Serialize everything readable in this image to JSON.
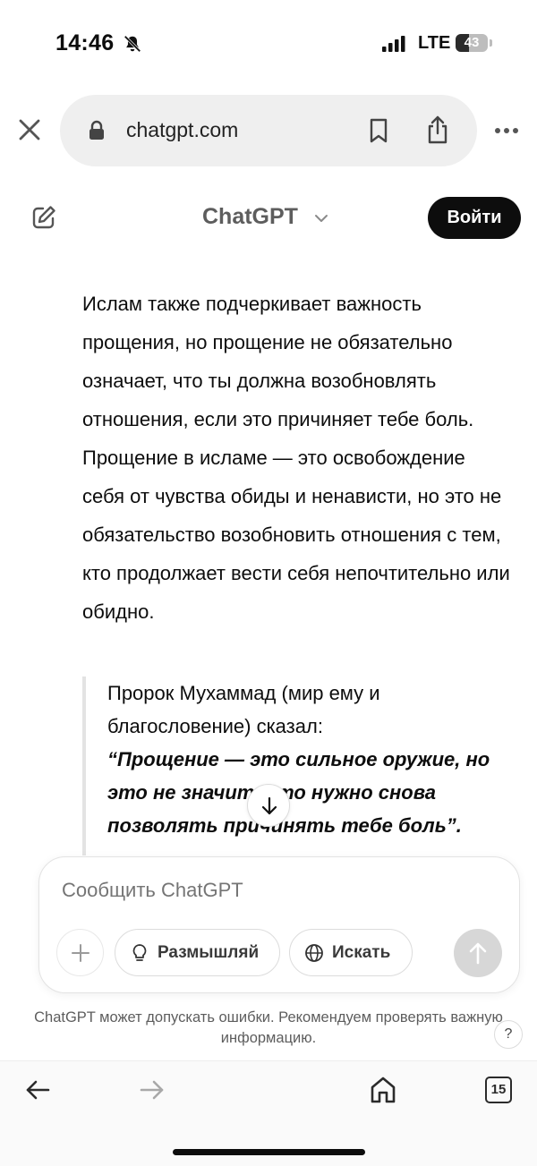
{
  "status_bar": {
    "time": "14:46",
    "network": "LTE",
    "battery": "43",
    "battery_level": 0.43
  },
  "browser": {
    "url": "chatgpt.com",
    "icons": [
      "close-icon",
      "lock-icon",
      "bookmark-icon",
      "share-icon",
      "more-icon"
    ]
  },
  "header": {
    "title": "ChatGPT",
    "login_label": "Войти"
  },
  "message": {
    "paragraph": "Ислам также подчеркивает важность прощения, но прощение не обязательно означает, что ты должна возобновлять отношения, если это причиняет тебе боль. Прощение в исламе — это освобождение себя от чувства обиды и ненависти, но это не обязательство возобновить отношения с тем, кто продолжает вести себя непочтительно или обидно.",
    "quote_intro": "Пророк Мухаммад (мир ему и благословение) сказал:",
    "quote_text": "“Прощение — это сильное оружие, но это не значит, что нужно снова позволять причинять тебе боль”."
  },
  "composer": {
    "placeholder": "Сообщить ChatGPT",
    "think_label": "Размышляй",
    "search_label": "Искать"
  },
  "footer": {
    "disclaimer": "ChatGPT может допускать ошибки. Рекомендуем проверять важную информацию.",
    "help_label": "?"
  },
  "toolbar": {
    "tabs_count": "15"
  },
  "colors": {
    "accent": "#0d0d0d",
    "muted_text": "#5d5d5d",
    "pill_bg": "#efefef"
  }
}
